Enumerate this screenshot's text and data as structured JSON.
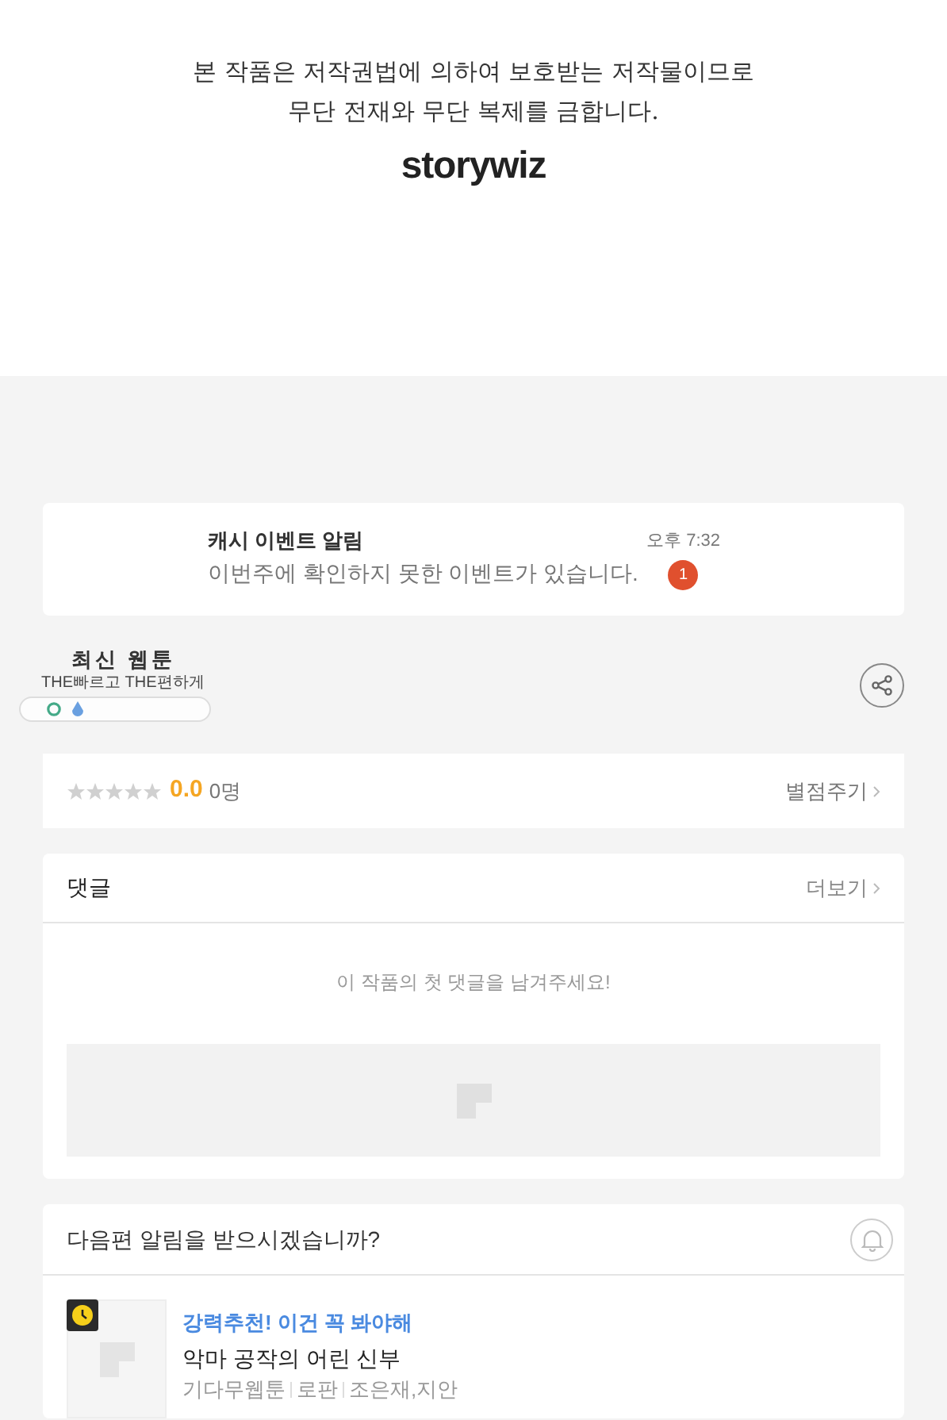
{
  "copyright_notice": {
    "lines": [
      "본 작품은 저작권법에 의하여 보호받는 저작물이므로",
      "무단 전재와 무단 복제를 금합니다."
    ],
    "logo": "storywiz"
  },
  "notification": {
    "title": "캐시 이벤트 알림",
    "message": "이번주에 확인하지 못한 이벤트가 있습니다.",
    "time": "오후 7:32",
    "badge": "1"
  },
  "promo": {
    "title": "최신 웹툰",
    "subtitle": "THE빠르고 THE편하게"
  },
  "rating": {
    "stars": 0,
    "score": "0.0",
    "count": "0명",
    "action": "별점주기"
  },
  "comments": {
    "title": "댓글",
    "more": "더보기",
    "empty_message": "이 작품의 첫 댓글을 남겨주세요!"
  },
  "subscribe": {
    "question": "다음편 알림을 받으시겠습니까?",
    "on": false
  },
  "recommendation": {
    "tagline": "강력추천! 이건 꼭 봐야해",
    "title": "악마 공작의 어린 신부",
    "meta": [
      "기다무웹툰",
      "로판",
      "조은재,지안"
    ]
  }
}
